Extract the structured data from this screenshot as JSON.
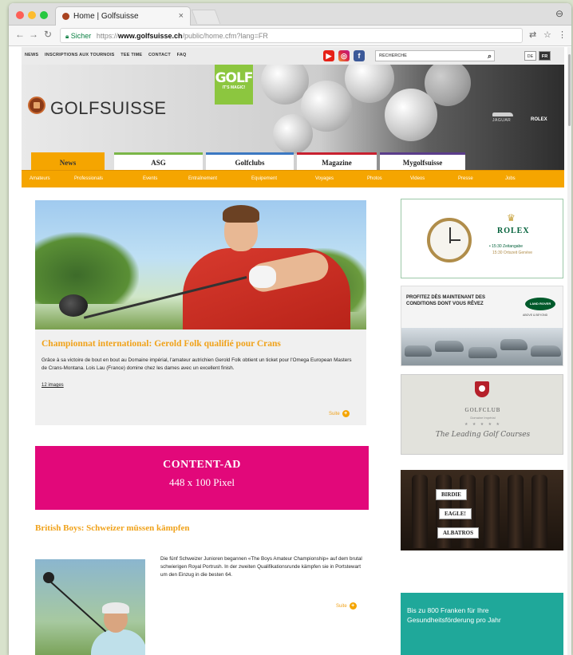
{
  "browser": {
    "tab_title": "Home | Golfsuisse",
    "tab_close": "×",
    "secure_label": "Sicher",
    "url_prefix": "https://",
    "url_host": "www.golfsuisse.ch",
    "url_path": "/public/home.cfm?lang=FR",
    "icons": [
      "back-icon",
      "forward-icon",
      "reload-icon",
      "lock-icon",
      "translate-icon",
      "star-icon",
      "menu-icon",
      "profile-icon"
    ]
  },
  "topbar": {
    "links": [
      "NEWS",
      "INSCRIPTIONS AUX TOURNOIS",
      "TEE TIME",
      "CONTACT",
      "FAQ"
    ],
    "search_placeholder": "RECHERCHE",
    "lang_de": "DE",
    "lang_fr": "FR",
    "social": {
      "youtube": "▶",
      "instagram": "◎",
      "facebook": "f"
    }
  },
  "header": {
    "logo_text": "GOLFSUISSE",
    "golf_main": "GOLF",
    "golf_sub": "IT'S MAGIC!",
    "jaguar": "JAGUAR",
    "rolex": "ROLEX"
  },
  "mainnav": {
    "items": [
      {
        "label": "News",
        "color": "#f5a500"
      },
      {
        "label": "ASG",
        "color": "#7ab648"
      },
      {
        "label": "Golfclubs",
        "color": "#3b78c2"
      },
      {
        "label": "Magazine",
        "color": "#c8202f"
      },
      {
        "label": "Mygolfsuisse",
        "color": "#5b3d8b"
      }
    ]
  },
  "subnav": {
    "items": [
      "Amateurs",
      "Professionals",
      "Events",
      "Entraînement",
      "Equipement",
      "Voyages",
      "Photos",
      "Videos",
      "Presse",
      "Jobs"
    ]
  },
  "featured": {
    "title": "Championnat international: Gerold Folk qualifié pour Crans",
    "text": "Grâce à sa victoire de bout en bout au Domaine impérial, l'amateur autrichien Gerold Folk obtient un ticket pour l'Omega European Masters de Crans-Montana. Lois Lau (France) domine chez les dames avec un excellent finish.",
    "images_link": "12 images",
    "suite": "Suite",
    "suite_icon": "+"
  },
  "content_ad": {
    "title": "CONTENT-AD",
    "subtitle": "448 x 100 Pixel"
  },
  "article2": {
    "title": "British Boys: Schweizer müssen kämpfen",
    "text": "Die fünf Schweizer Junioren begannen «The Boys Amateur Championship» auf dem brutal schwierigen Royal Portrush. In der zweiten Qualifikationsrunde kämpfen sie in Portstewart um den Einzug in die besten 64.",
    "suite": "Suite",
    "suite_icon": "+"
  },
  "sidebar": {
    "rolex": {
      "crown": "♛",
      "name": "ROLEX",
      "line1": "• 15:30 Zeitangabe",
      "line2": "15:30 Ortszeit Genève"
    },
    "landrover": {
      "text": "PROFITEZ DÈS MAINTENANT DES CONDITIONS DONT VOUS RÊVEZ",
      "logo": "LAND ROVER",
      "sub": "ABOVE & BEYOND"
    },
    "golfclub": {
      "name": "GOLFCLUB",
      "sub": "Domaine Impérial",
      "stars": "★ ★ ★ ★ ★",
      "script": "The Leading Golf Courses"
    },
    "wine": {
      "labels": [
        "BIRDIE",
        "EAGLE!",
        "ALBATROS"
      ]
    },
    "health": {
      "text": "Bis zu 800 Franken für Ihre Gesundheitsförderung pro Jahr"
    }
  }
}
